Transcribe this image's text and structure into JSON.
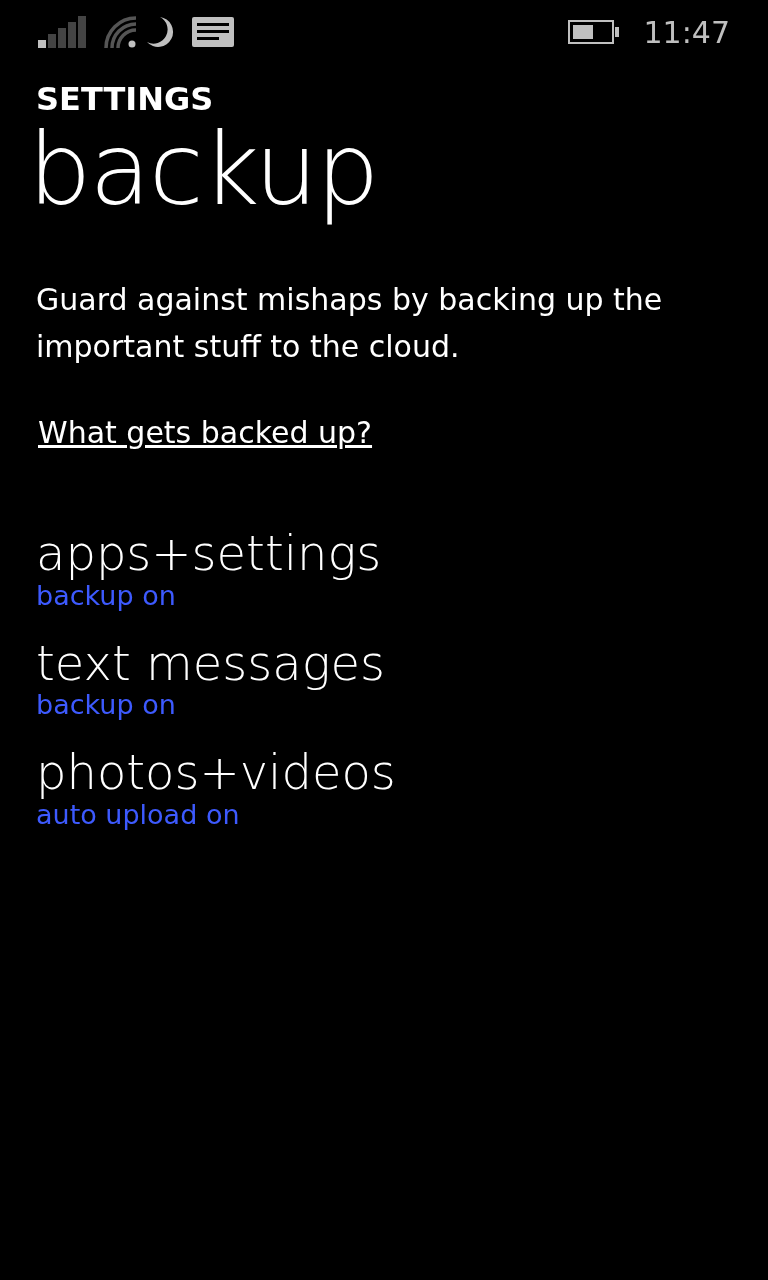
{
  "status_bar": {
    "time": "11:47"
  },
  "header": {
    "app_title": "SETTINGS",
    "page_title": "backup"
  },
  "description": "Guard against mishaps by backing up the important stuff to the cloud.",
  "link": "What gets backed up?",
  "items": [
    {
      "title": "apps+settings",
      "status": "backup on"
    },
    {
      "title": "text messages",
      "status": "backup on"
    },
    {
      "title": "photos+videos",
      "status": "auto upload on"
    }
  ]
}
